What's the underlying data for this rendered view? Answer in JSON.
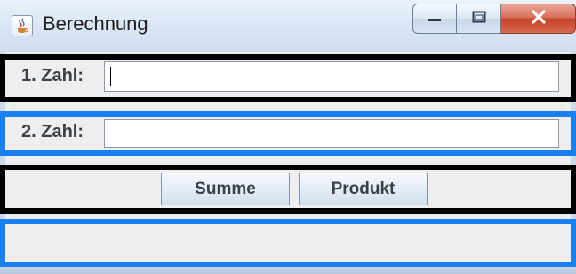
{
  "window": {
    "title": "Berechnung",
    "icons": {
      "app": "java-coffee-cup-icon",
      "minimize": "minimize-icon",
      "maximize": "maximize-icon",
      "close": "close-icon"
    },
    "close_button_color": "#c6432a"
  },
  "form": {
    "field1": {
      "label": "1. Zahl:",
      "value": ""
    },
    "field2": {
      "label": "2. Zahl:",
      "value": ""
    }
  },
  "buttons": {
    "sum_label": "Summe",
    "product_label": "Produkt"
  },
  "result": {
    "text": ""
  },
  "highlights": {
    "black": "#000000",
    "blue": "#1a7ff0"
  }
}
